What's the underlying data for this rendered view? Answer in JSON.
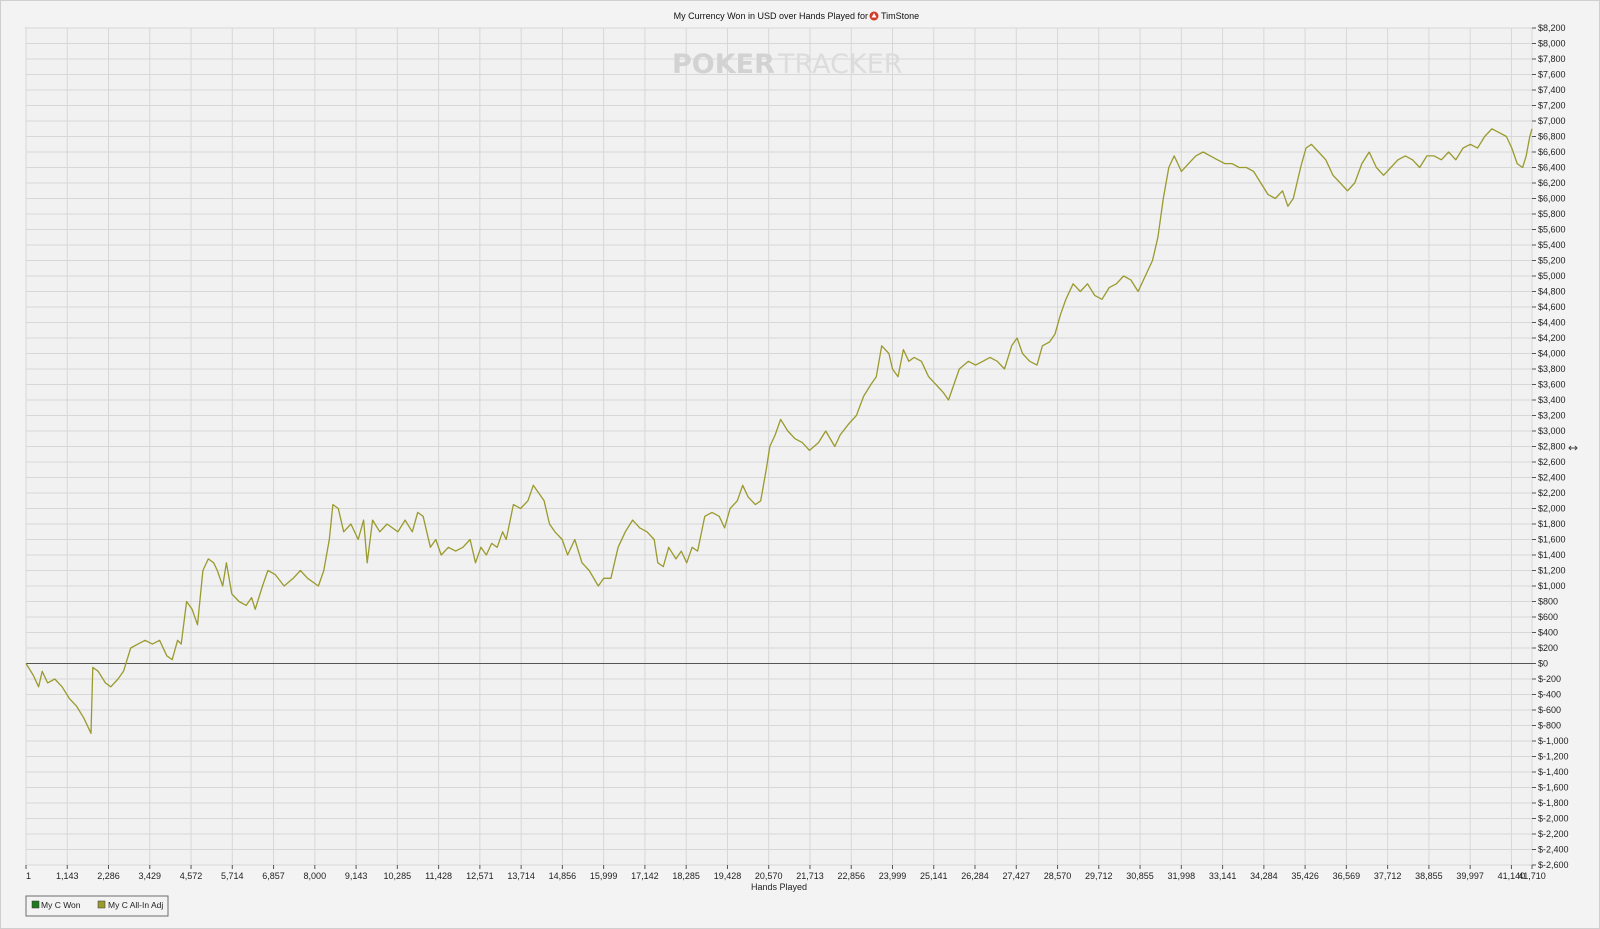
{
  "chart_data": {
    "type": "line",
    "title": "My Currency Won in USD over Hands Played for",
    "title_player": "TimStone",
    "watermark": "POKERTRACKER",
    "xlabel": "Hands Played",
    "ylabel": "",
    "xlim": [
      1,
      41710
    ],
    "ylim": [
      -2600,
      8200
    ],
    "y_axis_side": "right",
    "grid": true,
    "legend_position": "bottom-left",
    "x_tick_labels": [
      "1",
      "1,143",
      "2,286",
      "3,429",
      "4,572",
      "5,714",
      "6,857",
      "8,000",
      "9,143",
      "10,285",
      "11,428",
      "12,571",
      "13,714",
      "14,856",
      "15,999",
      "17,142",
      "18,285",
      "19,428",
      "20,570",
      "21,713",
      "22,856",
      "23,999",
      "25,141",
      "26,284",
      "27,427",
      "28,570",
      "29,712",
      "30,855",
      "31,998",
      "33,141",
      "34,284",
      "35,426",
      "36,569",
      "37,712",
      "38,855",
      "39,997",
      "41,140",
      "41,710"
    ],
    "y_tick_labels": [
      "$8,200",
      "$8,000",
      "$7,800",
      "$7,600",
      "$7,400",
      "$7,200",
      "$7,000",
      "$6,800",
      "$6,600",
      "$6,400",
      "$6,200",
      "$6,000",
      "$5,800",
      "$5,600",
      "$5,400",
      "$5,200",
      "$5,000",
      "$4,800",
      "$4,600",
      "$4,400",
      "$4,200",
      "$4,000",
      "$3,800",
      "$3,600",
      "$3,400",
      "$3,200",
      "$3,000",
      "$2,800",
      "$2,600",
      "$2,400",
      "$2,200",
      "$2,000",
      "$1,800",
      "$1,600",
      "$1,400",
      "$1,200",
      "$1,000",
      "$800",
      "$600",
      "$400",
      "$200",
      "$0",
      "$-200",
      "$-400",
      "$-600",
      "$-800",
      "$-1,000",
      "$-1,200",
      "$-1,400",
      "$-1,600",
      "$-1,800",
      "$-2,000",
      "$-2,200",
      "$-2,400",
      "$-2,600"
    ],
    "series": [
      {
        "name": "My C Won",
        "color": "#1f7a1f",
        "values_xy": []
      },
      {
        "name": "My C All-In Adj",
        "color": "#9a9a2e",
        "values_xy": [
          [
            1,
            0
          ],
          [
            200,
            -150
          ],
          [
            350,
            -300
          ],
          [
            450,
            -100
          ],
          [
            600,
            -250
          ],
          [
            800,
            -200
          ],
          [
            1000,
            -300
          ],
          [
            1200,
            -450
          ],
          [
            1400,
            -550
          ],
          [
            1600,
            -700
          ],
          [
            1800,
            -900
          ],
          [
            1850,
            -50
          ],
          [
            2000,
            -100
          ],
          [
            2200,
            -250
          ],
          [
            2350,
            -300
          ],
          [
            2550,
            -200
          ],
          [
            2700,
            -100
          ],
          [
            2900,
            200
          ],
          [
            3100,
            250
          ],
          [
            3300,
            300
          ],
          [
            3500,
            250
          ],
          [
            3700,
            300
          ],
          [
            3900,
            100
          ],
          [
            4050,
            50
          ],
          [
            4200,
            300
          ],
          [
            4300,
            250
          ],
          [
            4450,
            800
          ],
          [
            4600,
            700
          ],
          [
            4750,
            500
          ],
          [
            4900,
            1200
          ],
          [
            5050,
            1350
          ],
          [
            5200,
            1300
          ],
          [
            5300,
            1200
          ],
          [
            5450,
            1000
          ],
          [
            5550,
            1300
          ],
          [
            5700,
            900
          ],
          [
            5900,
            800
          ],
          [
            6100,
            750
          ],
          [
            6250,
            850
          ],
          [
            6350,
            700
          ],
          [
            6550,
            1000
          ],
          [
            6700,
            1200
          ],
          [
            6900,
            1150
          ],
          [
            7150,
            1000
          ],
          [
            7400,
            1100
          ],
          [
            7600,
            1200
          ],
          [
            7800,
            1100
          ],
          [
            8100,
            1000
          ],
          [
            8250,
            1200
          ],
          [
            8400,
            1600
          ],
          [
            8500,
            2050
          ],
          [
            8650,
            2000
          ],
          [
            8800,
            1700
          ],
          [
            9000,
            1800
          ],
          [
            9200,
            1600
          ],
          [
            9350,
            1850
          ],
          [
            9450,
            1300
          ],
          [
            9600,
            1850
          ],
          [
            9800,
            1700
          ],
          [
            10000,
            1800
          ],
          [
            10300,
            1700
          ],
          [
            10500,
            1850
          ],
          [
            10700,
            1700
          ],
          [
            10850,
            1950
          ],
          [
            11000,
            1900
          ],
          [
            11200,
            1500
          ],
          [
            11350,
            1600
          ],
          [
            11500,
            1400
          ],
          [
            11700,
            1500
          ],
          [
            11900,
            1450
          ],
          [
            12100,
            1500
          ],
          [
            12300,
            1600
          ],
          [
            12450,
            1300
          ],
          [
            12600,
            1500
          ],
          [
            12750,
            1400
          ],
          [
            12900,
            1550
          ],
          [
            13050,
            1500
          ],
          [
            13200,
            1700
          ],
          [
            13300,
            1600
          ],
          [
            13500,
            2050
          ],
          [
            13700,
            2000
          ],
          [
            13900,
            2100
          ],
          [
            14050,
            2300
          ],
          [
            14200,
            2200
          ],
          [
            14350,
            2100
          ],
          [
            14500,
            1800
          ],
          [
            14650,
            1700
          ],
          [
            14850,
            1600
          ],
          [
            15000,
            1400
          ],
          [
            15200,
            1600
          ],
          [
            15400,
            1300
          ],
          [
            15600,
            1200
          ],
          [
            15850,
            1000
          ],
          [
            16000,
            1100
          ],
          [
            16200,
            1100
          ],
          [
            16400,
            1500
          ],
          [
            16600,
            1700
          ],
          [
            16800,
            1850
          ],
          [
            17000,
            1750
          ],
          [
            17200,
            1700
          ],
          [
            17400,
            1600
          ],
          [
            17500,
            1300
          ],
          [
            17650,
            1250
          ],
          [
            17800,
            1500
          ],
          [
            18000,
            1350
          ],
          [
            18150,
            1450
          ],
          [
            18300,
            1300
          ],
          [
            18450,
            1500
          ],
          [
            18600,
            1450
          ],
          [
            18800,
            1900
          ],
          [
            19000,
            1950
          ],
          [
            19200,
            1900
          ],
          [
            19350,
            1750
          ],
          [
            19500,
            2000
          ],
          [
            19700,
            2100
          ],
          [
            19850,
            2300
          ],
          [
            20000,
            2150
          ],
          [
            20200,
            2050
          ],
          [
            20350,
            2100
          ],
          [
            20500,
            2500
          ],
          [
            20600,
            2800
          ],
          [
            20750,
            2950
          ],
          [
            20900,
            3150
          ],
          [
            21100,
            3000
          ],
          [
            21300,
            2900
          ],
          [
            21500,
            2850
          ],
          [
            21700,
            2750
          ],
          [
            21950,
            2850
          ],
          [
            22150,
            3000
          ],
          [
            22400,
            2800
          ],
          [
            22550,
            2950
          ],
          [
            22800,
            3100
          ],
          [
            23000,
            3200
          ],
          [
            23200,
            3450
          ],
          [
            23400,
            3600
          ],
          [
            23550,
            3700
          ],
          [
            23700,
            4100
          ],
          [
            23900,
            4000
          ],
          [
            24000,
            3800
          ],
          [
            24150,
            3700
          ],
          [
            24300,
            4050
          ],
          [
            24450,
            3900
          ],
          [
            24600,
            3950
          ],
          [
            24800,
            3900
          ],
          [
            25000,
            3700
          ],
          [
            25200,
            3600
          ],
          [
            25400,
            3500
          ],
          [
            25550,
            3400
          ],
          [
            25700,
            3600
          ],
          [
            25850,
            3800
          ],
          [
            26100,
            3900
          ],
          [
            26300,
            3850
          ],
          [
            26500,
            3900
          ],
          [
            26700,
            3950
          ],
          [
            26900,
            3900
          ],
          [
            27100,
            3800
          ],
          [
            27300,
            4100
          ],
          [
            27450,
            4200
          ],
          [
            27600,
            4000
          ],
          [
            27800,
            3900
          ],
          [
            28000,
            3850
          ],
          [
            28150,
            4100
          ],
          [
            28350,
            4150
          ],
          [
            28500,
            4250
          ],
          [
            28650,
            4500
          ],
          [
            28800,
            4700
          ],
          [
            29000,
            4900
          ],
          [
            29200,
            4800
          ],
          [
            29400,
            4900
          ],
          [
            29600,
            4750
          ],
          [
            29800,
            4700
          ],
          [
            30000,
            4850
          ],
          [
            30200,
            4900
          ],
          [
            30400,
            5000
          ],
          [
            30600,
            4950
          ],
          [
            30800,
            4800
          ],
          [
            31000,
            5000
          ],
          [
            31200,
            5200
          ],
          [
            31350,
            5500
          ],
          [
            31500,
            6000
          ],
          [
            31650,
            6400
          ],
          [
            31800,
            6550
          ],
          [
            32000,
            6350
          ],
          [
            32200,
            6450
          ],
          [
            32400,
            6550
          ],
          [
            32600,
            6600
          ],
          [
            32800,
            6550
          ],
          [
            33000,
            6500
          ],
          [
            33200,
            6450
          ],
          [
            33400,
            6450
          ],
          [
            33600,
            6400
          ],
          [
            33800,
            6400
          ],
          [
            34000,
            6350
          ],
          [
            34200,
            6200
          ],
          [
            34400,
            6050
          ],
          [
            34600,
            6000
          ],
          [
            34800,
            6100
          ],
          [
            34950,
            5900
          ],
          [
            35100,
            6000
          ],
          [
            35300,
            6400
          ],
          [
            35450,
            6650
          ],
          [
            35600,
            6700
          ],
          [
            35800,
            6600
          ],
          [
            36000,
            6500
          ],
          [
            36200,
            6300
          ],
          [
            36400,
            6200
          ],
          [
            36600,
            6100
          ],
          [
            36800,
            6200
          ],
          [
            37000,
            6450
          ],
          [
            37200,
            6600
          ],
          [
            37400,
            6400
          ],
          [
            37600,
            6300
          ],
          [
            37800,
            6400
          ],
          [
            38000,
            6500
          ],
          [
            38200,
            6550
          ],
          [
            38400,
            6500
          ],
          [
            38600,
            6400
          ],
          [
            38800,
            6550
          ],
          [
            39000,
            6550
          ],
          [
            39200,
            6500
          ],
          [
            39400,
            6600
          ],
          [
            39600,
            6500
          ],
          [
            39800,
            6650
          ],
          [
            40000,
            6700
          ],
          [
            40200,
            6650
          ],
          [
            40400,
            6800
          ],
          [
            40600,
            6900
          ],
          [
            40800,
            6850
          ],
          [
            41000,
            6800
          ],
          [
            41150,
            6650
          ],
          [
            41300,
            6450
          ],
          [
            41450,
            6400
          ],
          [
            41550,
            6550
          ],
          [
            41650,
            6800
          ],
          [
            41710,
            6900
          ]
        ]
      }
    ]
  }
}
